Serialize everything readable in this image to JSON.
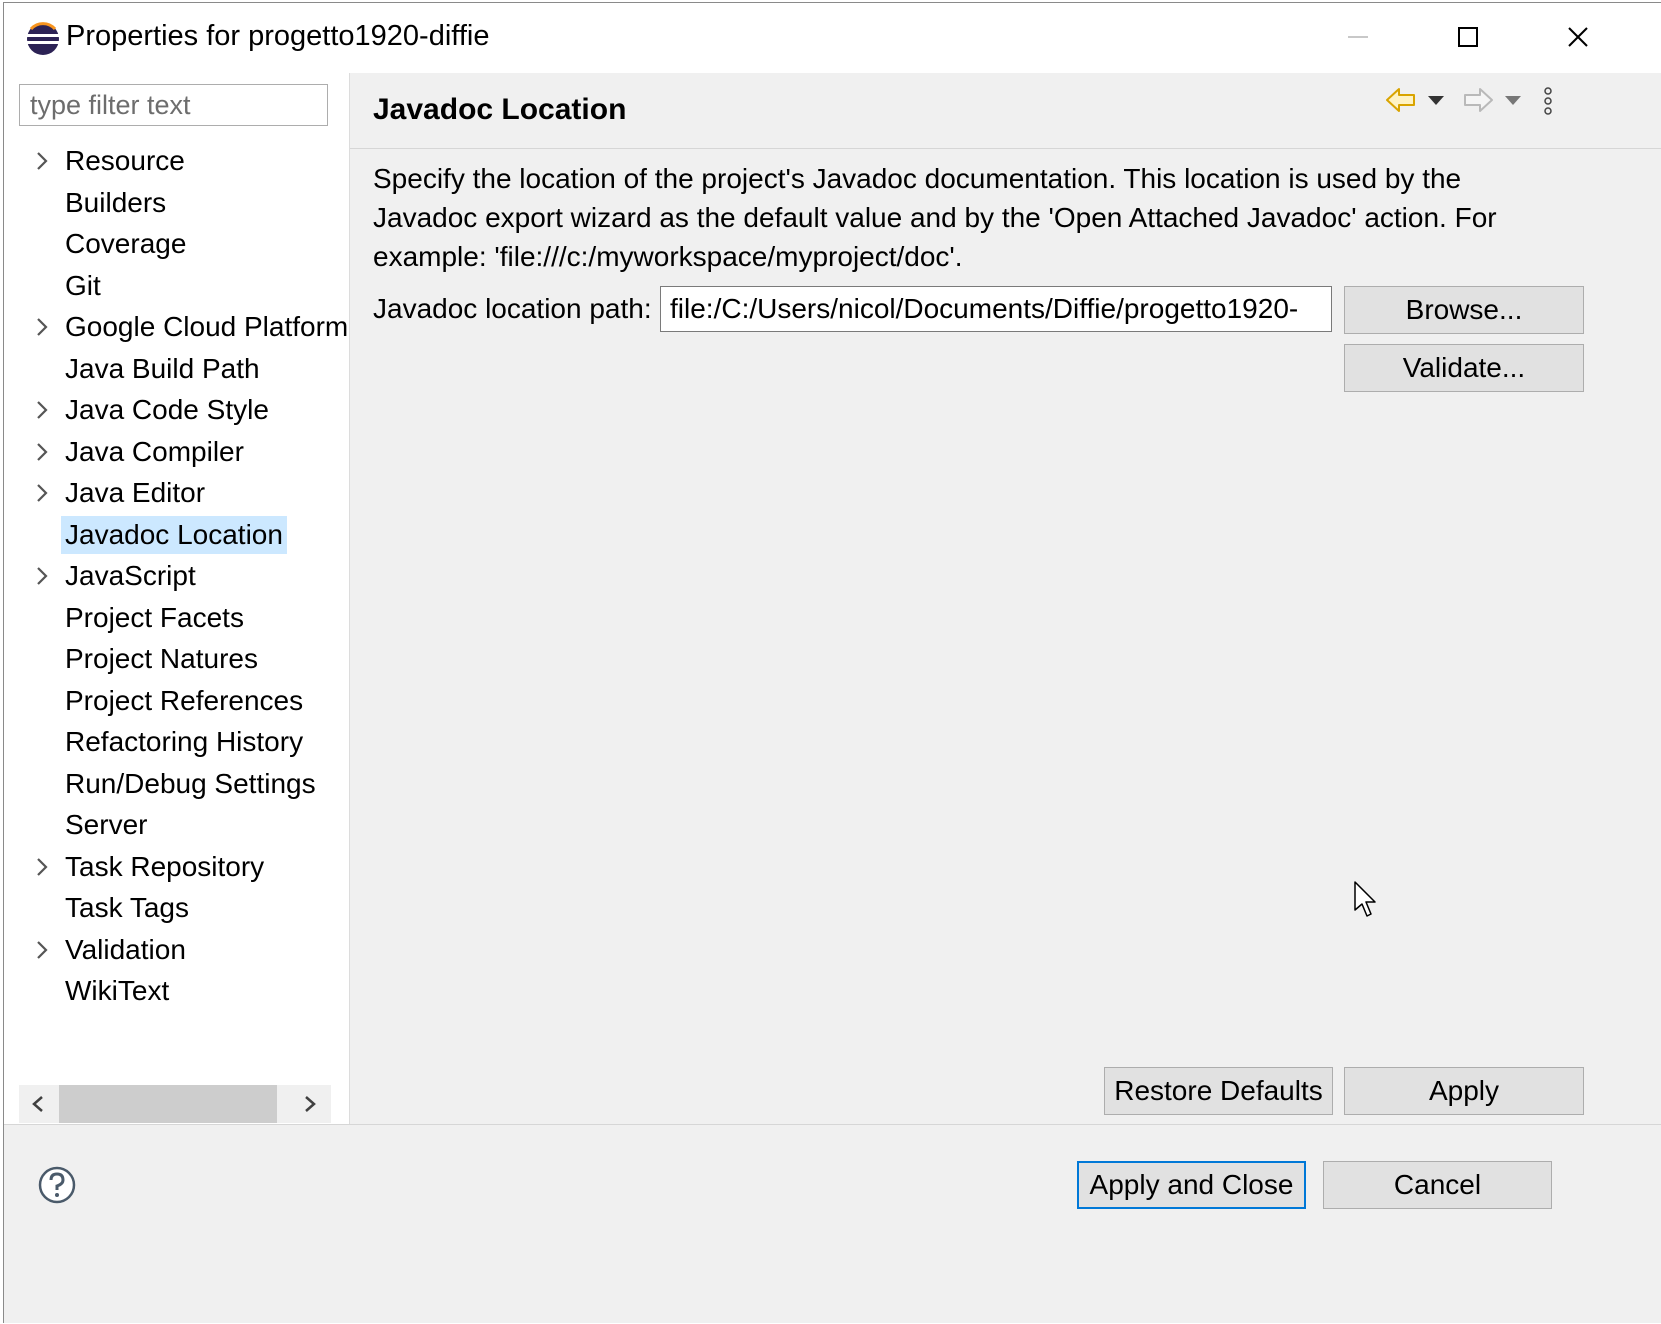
{
  "window": {
    "title": "Properties for progetto1920-diffie"
  },
  "titlebar_buttons": {
    "minimize": "minimize-icon",
    "maximize": "maximize-icon",
    "close": "close-icon"
  },
  "filter": {
    "placeholder": "type filter text",
    "value": ""
  },
  "tree": {
    "items": [
      {
        "label": "Resource",
        "expandable": true,
        "selected": false
      },
      {
        "label": "Builders",
        "expandable": false,
        "selected": false
      },
      {
        "label": "Coverage",
        "expandable": false,
        "selected": false
      },
      {
        "label": "Git",
        "expandable": false,
        "selected": false
      },
      {
        "label": "Google Cloud Platform",
        "expandable": true,
        "selected": false
      },
      {
        "label": "Java Build Path",
        "expandable": false,
        "selected": false
      },
      {
        "label": "Java Code Style",
        "expandable": true,
        "selected": false
      },
      {
        "label": "Java Compiler",
        "expandable": true,
        "selected": false
      },
      {
        "label": "Java Editor",
        "expandable": true,
        "selected": false
      },
      {
        "label": "Javadoc Location",
        "expandable": false,
        "selected": true
      },
      {
        "label": "JavaScript",
        "expandable": true,
        "selected": false
      },
      {
        "label": "Project Facets",
        "expandable": false,
        "selected": false
      },
      {
        "label": "Project Natures",
        "expandable": false,
        "selected": false
      },
      {
        "label": "Project References",
        "expandable": false,
        "selected": false
      },
      {
        "label": "Refactoring History",
        "expandable": false,
        "selected": false
      },
      {
        "label": "Run/Debug Settings",
        "expandable": false,
        "selected": false
      },
      {
        "label": "Server",
        "expandable": false,
        "selected": false
      },
      {
        "label": "Task Repository",
        "expandable": true,
        "selected": false
      },
      {
        "label": "Task Tags",
        "expandable": false,
        "selected": false
      },
      {
        "label": "Validation",
        "expandable": true,
        "selected": false
      },
      {
        "label": "WikiText",
        "expandable": false,
        "selected": false
      }
    ]
  },
  "page": {
    "title": "Javadoc Location",
    "description": "Specify the location of the project's Javadoc documentation. This location is used by the Javadoc export wizard as the default value and by the 'Open Attached Javadoc' action. For example: 'file:///c:/myworkspace/myproject/doc'.",
    "path_label": "Javadoc location path:",
    "path_value": "file:/C:/Users/nicol/Documents/Diffie/progetto1920-",
    "browse_label": "Browse...",
    "validate_label": "Validate...",
    "restore_defaults_label": "Restore Defaults",
    "apply_label": "Apply"
  },
  "footer": {
    "apply_close_label": "Apply and Close",
    "cancel_label": "Cancel"
  },
  "colors": {
    "selection": "#cce8ff",
    "focus_border": "#0078d7",
    "back_arrow": "#d9a400"
  }
}
